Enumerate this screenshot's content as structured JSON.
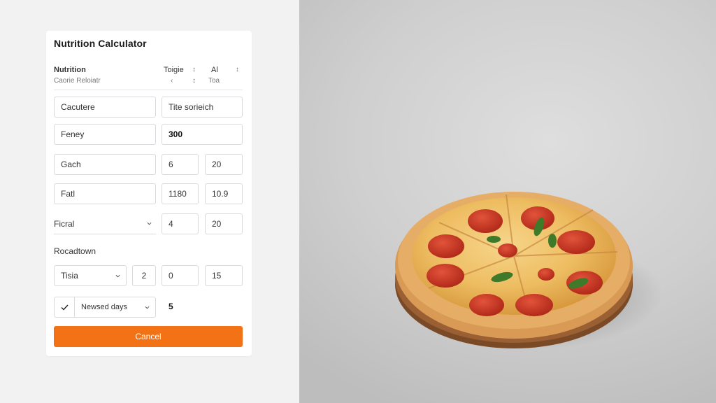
{
  "calculator": {
    "title": "Nutrition Calculator",
    "header": {
      "col1_line1": "Nutrition",
      "col1_line2": "Caorie Reloiatr",
      "col2_line1": "Toigie",
      "col2_line2": "‹",
      "sep1": "↕",
      "sep2": "↕",
      "col3_line1": "Al",
      "col3_line2": "Toa",
      "col4_line1": "↕"
    },
    "rows": {
      "r1_field1": "Cacutere",
      "r1_field2": "Tite sorieich",
      "r2_field1": "Feney",
      "r2_field2": "300",
      "r3_field1": "Gach",
      "r3_val1": "6",
      "r3_val2": "20",
      "r4_field1": "Fatl",
      "r4_val1": "1180",
      "r4_val2": "10.9",
      "r5_select": "Ficral",
      "r5_val1": "4",
      "r5_val2": "20"
    },
    "section_label": "Rocadtown",
    "breakdown": {
      "select": "Tisia",
      "val1": "2",
      "val2": "0",
      "val3": "15"
    },
    "checkbox_label": "Newsed days",
    "checkbox_value": "5",
    "cancel_label": "Cancel"
  },
  "colors": {
    "accent": "#f47216",
    "pane_bg": "#f2f2f3",
    "card_bg": "#ffffff",
    "border": "#d9dadd"
  },
  "icons": [
    "chevron-down-icon",
    "checkmark-icon"
  ],
  "photo": {
    "subject": "pepperoni pizza on wooden board, grey concrete surface"
  }
}
